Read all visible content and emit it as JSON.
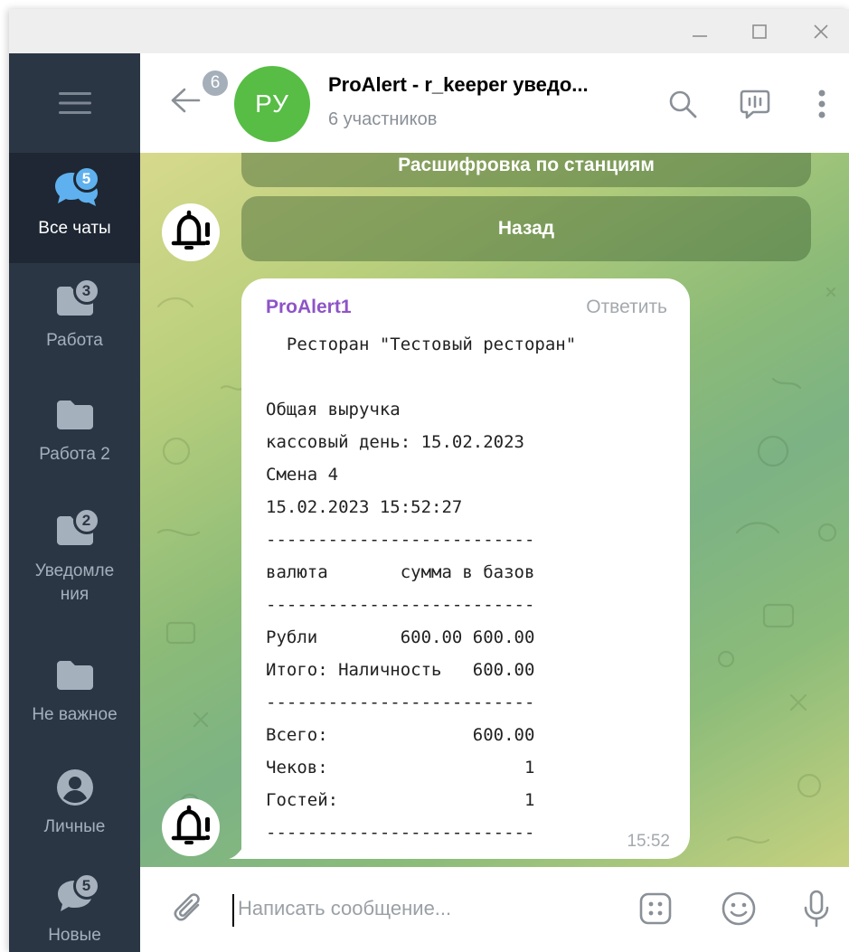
{
  "window_controls": {
    "minimize_icon": "minimize-icon",
    "maximize_icon": "maximize-icon",
    "close_icon": "close-icon"
  },
  "sidebar": {
    "menu_icon": "hamburger-icon",
    "folders": [
      {
        "label": "Все чаты",
        "badge": "5",
        "icon": "chats-icon",
        "active": true
      },
      {
        "label": "Работа",
        "badge": "3",
        "icon": "folder-icon",
        "active": false
      },
      {
        "label": "Работа 2",
        "badge": "",
        "icon": "folder-icon",
        "active": false
      },
      {
        "label": "Уведомле ния",
        "badge": "2",
        "icon": "folder-icon",
        "active": false
      },
      {
        "label": "Не важное",
        "badge": "",
        "icon": "folder-icon",
        "active": false
      },
      {
        "label": "Личные",
        "badge": "",
        "icon": "person-icon",
        "active": false
      },
      {
        "label": "Новые",
        "badge": "5",
        "icon": "chat-bubble-icon",
        "active": false
      }
    ]
  },
  "header": {
    "back_badge": "6",
    "avatar_initials": "РУ",
    "title": "ProAlert - r_keeper уведо...",
    "subtitle": "6 участников",
    "icons": [
      "search-icon",
      "voice-chat-icon",
      "more-vert-icon"
    ]
  },
  "keyboard": {
    "buttons": [
      "Расшифровка по станциям",
      "Назад"
    ]
  },
  "message": {
    "sender": "ProAlert1",
    "reply_label": "Ответить",
    "text": "  Ресторан \"Тестовый ресторан\"\n\nОбщая выручка\nкассовый день: 15.02.2023\nСмена 4\n15.02.2023 15:52:27\n--------------------------\nвалюта       сумма в базов\n--------------------------\nРубли        600.00 600.00\nИтого: Наличность   600.00\n--------------------------\nВсего:              600.00\nЧеков:                   1\nГостей:                  1\n--------------------------",
    "time": "15:52"
  },
  "composer": {
    "placeholder": "Написать сообщение...",
    "icons": [
      "attach-icon",
      "bot-commands-icon",
      "emoji-icon",
      "microphone-icon"
    ]
  },
  "colors": {
    "sidebar_bg": "#2b3645",
    "sidebar_active_bg": "#1e2733",
    "accent_badge": "#5fb0ee",
    "avatar_green": "#57bd45",
    "sender_purple": "#8e54c7"
  }
}
